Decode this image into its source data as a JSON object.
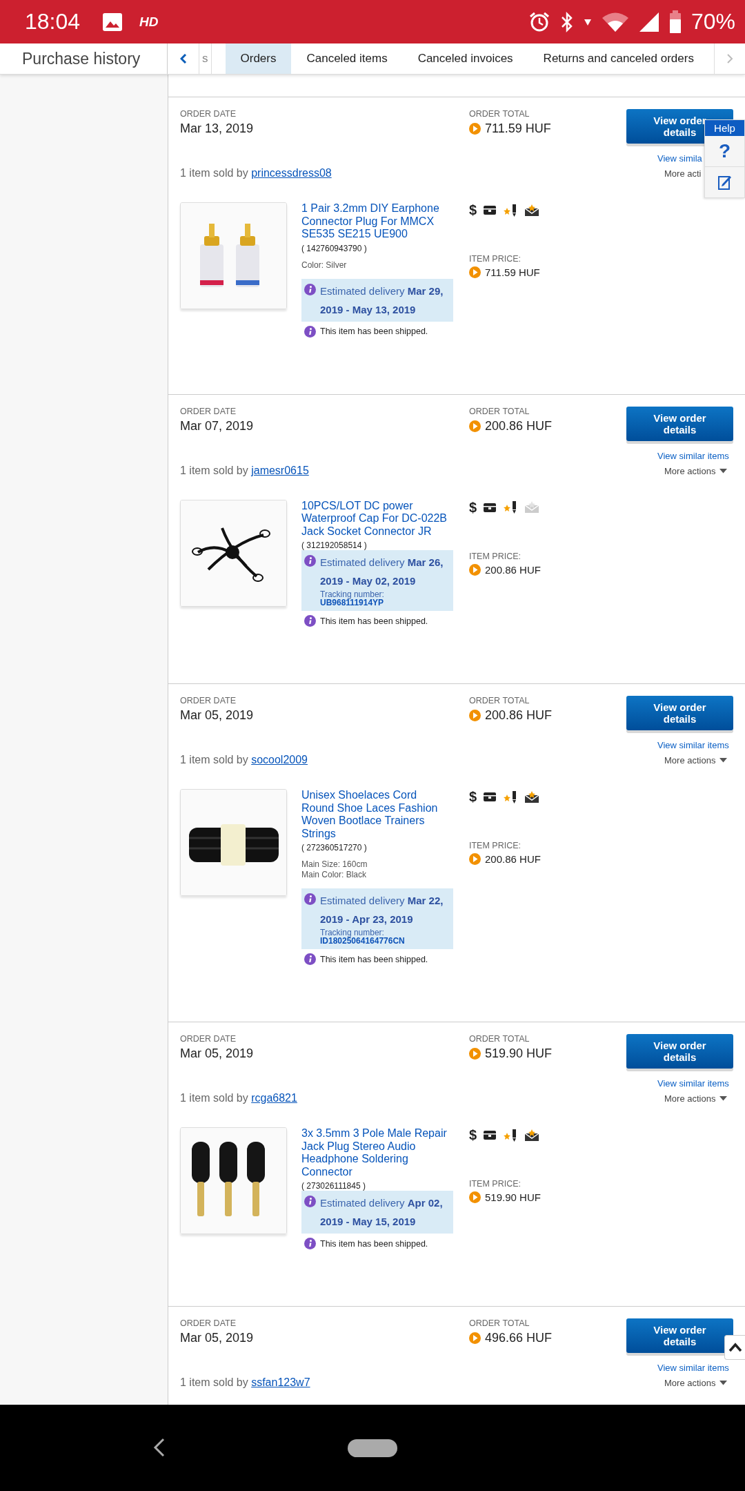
{
  "status_bar": {
    "time": "18:04",
    "hd": "HD",
    "battery": "70%"
  },
  "header": {
    "title": "Purchase history"
  },
  "tabs": [
    {
      "label": "s",
      "selected": false
    },
    {
      "label": "Orders",
      "selected": true
    },
    {
      "label": "Canceled items",
      "selected": false
    },
    {
      "label": "Canceled invoices",
      "selected": false
    },
    {
      "label": "Returns and canceled orders",
      "selected": false
    }
  ],
  "help": {
    "label": "Help",
    "question": "?"
  },
  "orders": [
    {
      "date_label": "ORDER DATE",
      "date": "Mar 13, 2019",
      "total_label": "ORDER TOTAL",
      "total": "711.59 HUF",
      "button": "View order details",
      "similar": "View simila",
      "more": "More acti",
      "more_caret": false,
      "seller_prefix": "1 item sold by",
      "seller": "princessdress08",
      "item": {
        "title": "1 Pair 3.2mm DIY Earphone Connector Plug For MMCX SE535 SE215 UE900",
        "number": "( 142760943790 )",
        "details": [
          "Color: Silver"
        ],
        "delivery": "Estimated delivery **Mar 29, 2019 - May 13, 2019**",
        "shipped": "This item has been shipped.",
        "paid_symbol": "$",
        "mail_active": true,
        "price_label": "ITEM PRICE:",
        "price": "711.59 HUF"
      }
    },
    {
      "date_label": "ORDER DATE",
      "date": "Mar 07, 2019",
      "total_label": "ORDER TOTAL",
      "total": "200.86 HUF",
      "button": "View order details",
      "similar": "View similar items",
      "more": "More actions",
      "more_caret": true,
      "seller_prefix": "1 item sold by",
      "seller": "jamesr0615",
      "item": {
        "title": "10PCS/LOT DC power Waterproof Cap For DC-022B Jack Socket Connector JR",
        "number": "( 312192058514 )",
        "delivery": "Estimated delivery **Mar 26, 2019 - May 02, 2019**",
        "tracking_label": "Tracking number:",
        "tracking_number": "UB968111914YP",
        "shipped": "This item has been shipped.",
        "paid_symbol": "$",
        "mail_active": false,
        "price_label": "ITEM PRICE:",
        "price": "200.86 HUF"
      }
    },
    {
      "date_label": "ORDER DATE",
      "date": "Mar 05, 2019",
      "total_label": "ORDER TOTAL",
      "total": "200.86 HUF",
      "button": "View order details",
      "similar": "View similar items",
      "more": "More actions",
      "more_caret": true,
      "seller_prefix": "1 item sold by",
      "seller": "socool2009",
      "item": {
        "title": "Unisex Shoelaces Cord Round Shoe Laces Fashion Woven Bootlace Trainers Strings",
        "number": "( 272360517270 )",
        "details": [
          "Main Size: 160cm",
          "Main Color: Black"
        ],
        "delivery": "Estimated delivery **Mar 22, 2019 - Apr 23, 2019**",
        "tracking_label": "Tracking number:",
        "tracking_number": "ID18025064164776CN",
        "shipped": "This item has been shipped.",
        "paid_symbol": "$",
        "mail_active": true,
        "price_label": "ITEM PRICE:",
        "price": "200.86 HUF"
      }
    },
    {
      "date_label": "ORDER DATE",
      "date": "Mar 05, 2019",
      "total_label": "ORDER TOTAL",
      "total": "519.90 HUF",
      "button": "View order details",
      "similar": "View similar items",
      "more": "More actions",
      "more_caret": true,
      "seller_prefix": "1 item sold by",
      "seller": "rcga6821",
      "item": {
        "title": "3x 3.5mm 3 Pole Male Repair Jack Plug Stereo Audio Headphone Soldering Connector",
        "number": "( 273026111845 )",
        "delivery": "Estimated delivery **Apr 02, 2019 - May 15, 2019**",
        "shipped": "This item has been shipped.",
        "paid_symbol": "$",
        "mail_active": true,
        "price_label": "ITEM PRICE:",
        "price": "519.90 HUF"
      }
    },
    {
      "date_label": "ORDER DATE",
      "date": "Mar 05, 2019",
      "total_label": "ORDER TOTAL",
      "total": "496.66 HUF",
      "button": "View order details",
      "similar": "View similar items",
      "more": "More actions",
      "more_caret": true,
      "seller_prefix": "1 item sold by",
      "seller": "ssfan123w7"
    }
  ]
}
